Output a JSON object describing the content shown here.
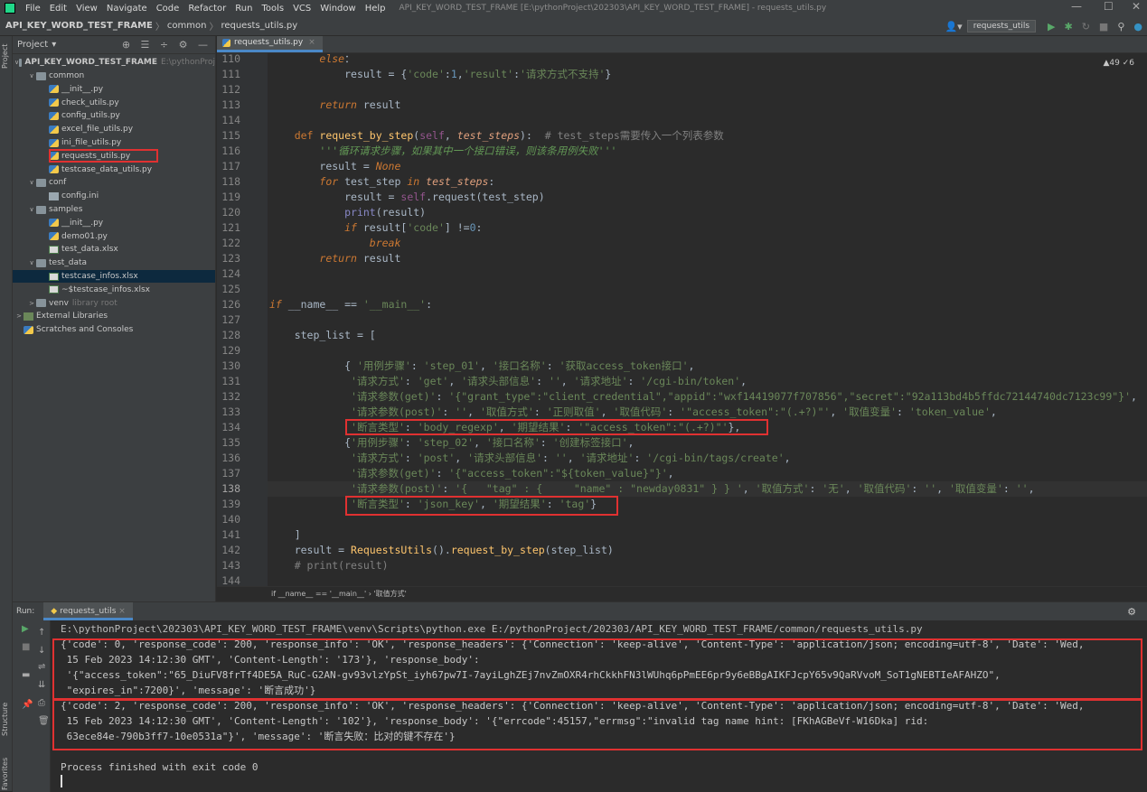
{
  "menubar": {
    "items": [
      "File",
      "Edit",
      "View",
      "Navigate",
      "Code",
      "Refactor",
      "Run",
      "Tools",
      "VCS",
      "Window",
      "Help"
    ],
    "window_title": "API_KEY_WORD_TEST_FRAME [E:\\pythonProject\\202303\\API_KEY_WORD_TEST_FRAME] - requests_utils.py"
  },
  "navbar": {
    "crumbs": [
      "API_KEY_WORD_TEST_FRAME",
      "common",
      "requests_utils.py"
    ],
    "run_config": "requests_utils"
  },
  "sidebar_vertical": {
    "project": "Project",
    "structure": "Structure",
    "favorites": "Favorites"
  },
  "project": {
    "title": "Project",
    "tree": [
      {
        "label": "API_KEY_WORD_TEST_FRAME",
        "extra": "E:\\pythonProj",
        "indent": 0,
        "arrow": "v",
        "icon": "folder",
        "bold": true
      },
      {
        "label": "common",
        "indent": 1,
        "arrow": "v",
        "icon": "folder"
      },
      {
        "label": "__init__.py",
        "indent": 2,
        "icon": "py"
      },
      {
        "label": "check_utils.py",
        "indent": 2,
        "icon": "py"
      },
      {
        "label": "config_utils.py",
        "indent": 2,
        "icon": "py"
      },
      {
        "label": "excel_file_utils.py",
        "indent": 2,
        "icon": "py"
      },
      {
        "label": "ini_file_utils.py",
        "indent": 2,
        "icon": "py"
      },
      {
        "label": "requests_utils.py",
        "indent": 2,
        "icon": "py"
      },
      {
        "label": "testcase_data_utils.py",
        "indent": 2,
        "icon": "py"
      },
      {
        "label": "conf",
        "indent": 1,
        "arrow": "v",
        "icon": "folder"
      },
      {
        "label": "config.ini",
        "indent": 2,
        "icon": "ini"
      },
      {
        "label": "samples",
        "indent": 1,
        "arrow": "v",
        "icon": "folder"
      },
      {
        "label": "__init__.py",
        "indent": 2,
        "icon": "py"
      },
      {
        "label": "demo01.py",
        "indent": 2,
        "icon": "py"
      },
      {
        "label": "test_data.xlsx",
        "indent": 2,
        "icon": "xls"
      },
      {
        "label": "test_data",
        "indent": 1,
        "arrow": "v",
        "icon": "folder"
      },
      {
        "label": "testcase_infos.xlsx",
        "indent": 2,
        "icon": "xls",
        "selected": true
      },
      {
        "label": "~$testcase_infos.xlsx",
        "indent": 2,
        "icon": "xls"
      },
      {
        "label": "venv",
        "extra": "library root",
        "indent": 1,
        "arrow": ">",
        "icon": "folder"
      },
      {
        "label": "External Libraries",
        "indent": 0,
        "arrow": ">",
        "icon": "lib"
      },
      {
        "label": "Scratches and Consoles",
        "indent": 0,
        "icon": "py"
      }
    ]
  },
  "editor": {
    "tab": "requests_utils.py",
    "inspection": "▲49  ✓6",
    "breadcrumb": "if __name__ == '__main__'  ›  '取值方式'",
    "line_numbers": [
      110,
      111,
      112,
      113,
      114,
      115,
      116,
      117,
      118,
      119,
      120,
      121,
      122,
      123,
      124,
      125,
      126,
      127,
      128,
      129,
      130,
      131,
      132,
      133,
      134,
      135,
      136,
      137,
      138,
      139,
      140,
      141,
      142,
      143,
      144
    ],
    "lines": [
      {
        "indent": "        ",
        "segs": [
          [
            "kwi",
            "else"
          ],
          [
            "",
            "："
          ]
        ]
      },
      {
        "indent": "            ",
        "segs": [
          [
            "",
            "result = {"
          ],
          [
            "st",
            "'code'"
          ],
          [
            "",
            ":"
          ],
          [
            "nu",
            "1"
          ],
          [
            "",
            ","
          ],
          [
            "st",
            "'result'"
          ],
          [
            "",
            ":"
          ],
          [
            "st",
            "'请求方式不支持'"
          ],
          [
            "",
            "}"
          ]
        ]
      },
      {
        "indent": "",
        "segs": []
      },
      {
        "indent": "        ",
        "segs": [
          [
            "kwi",
            "return"
          ],
          [
            "",
            " result"
          ]
        ]
      },
      {
        "indent": "",
        "segs": []
      },
      {
        "indent": "    ",
        "segs": [
          [
            "kw",
            "def "
          ],
          [
            "fn",
            "request_by_step"
          ],
          [
            "",
            "("
          ],
          [
            "se",
            "self"
          ],
          [
            "",
            ", "
          ],
          [
            "param",
            "test_steps"
          ],
          [
            "",
            "):  "
          ],
          [
            "cm",
            "# test_steps需要传入一个列表参数"
          ]
        ]
      },
      {
        "indent": "        ",
        "segs": [
          [
            "dc",
            "'''循环请求步骤，如果其中一个接口错误，则该条用例失败'''"
          ]
        ]
      },
      {
        "indent": "        ",
        "segs": [
          [
            "",
            "result = "
          ],
          [
            "kwi",
            "None"
          ]
        ]
      },
      {
        "indent": "        ",
        "segs": [
          [
            "kwi",
            "for"
          ],
          [
            "",
            " test_step "
          ],
          [
            "kwi",
            "in"
          ],
          [
            "",
            " "
          ],
          [
            "param",
            "test_steps"
          ],
          [
            "",
            ":"
          ]
        ]
      },
      {
        "indent": "            ",
        "segs": [
          [
            "",
            "result = "
          ],
          [
            "se",
            "self"
          ],
          [
            "",
            ".request(test_step)"
          ]
        ]
      },
      {
        "indent": "            ",
        "segs": [
          [
            "bi",
            "print"
          ],
          [
            "",
            "(result)"
          ]
        ]
      },
      {
        "indent": "            ",
        "segs": [
          [
            "kwi",
            "if"
          ],
          [
            "",
            " result["
          ],
          [
            "st",
            "'code'"
          ],
          [
            "",
            "] !="
          ],
          [
            "nu",
            "0"
          ],
          [
            "",
            ":"
          ]
        ]
      },
      {
        "indent": "                ",
        "segs": [
          [
            "kwi",
            "break"
          ]
        ]
      },
      {
        "indent": "        ",
        "segs": [
          [
            "kwi",
            "return"
          ],
          [
            "",
            " result"
          ]
        ]
      },
      {
        "indent": "",
        "segs": []
      },
      {
        "indent": "",
        "segs": []
      },
      {
        "indent": "",
        "segs": [
          [
            "kwi",
            "if"
          ],
          [
            "",
            " __name__ == "
          ],
          [
            "st",
            "'__main__'"
          ],
          [
            "",
            ":"
          ]
        ]
      },
      {
        "indent": "",
        "segs": []
      },
      {
        "indent": "    ",
        "segs": [
          [
            "",
            "step_list = ["
          ]
        ]
      },
      {
        "indent": "",
        "segs": []
      },
      {
        "indent": "            ",
        "segs": [
          [
            "",
            "{ "
          ],
          [
            "st",
            "'用例步骤'"
          ],
          [
            "",
            ": "
          ],
          [
            "st",
            "'step_01'"
          ],
          [
            "",
            ", "
          ],
          [
            "st",
            "'接口名称'"
          ],
          [
            "",
            ": "
          ],
          [
            "st",
            "'获取access_token接口'"
          ],
          [
            "",
            ","
          ]
        ]
      },
      {
        "indent": "             ",
        "segs": [
          [
            "st",
            "'请求方式'"
          ],
          [
            "",
            ": "
          ],
          [
            "st",
            "'get'"
          ],
          [
            "",
            ", "
          ],
          [
            "st",
            "'请求头部信息'"
          ],
          [
            "",
            ": "
          ],
          [
            "st",
            "''"
          ],
          [
            "",
            ", "
          ],
          [
            "st",
            "'请求地址'"
          ],
          [
            "",
            ": "
          ],
          [
            "st",
            "'/cgi-bin/token'"
          ],
          [
            "",
            ","
          ]
        ]
      },
      {
        "indent": "             ",
        "segs": [
          [
            "st",
            "'请求参数(get)'"
          ],
          [
            "",
            ": "
          ],
          [
            "st",
            "'{\"grant_type\":\"client_credential\",\"appid\":\"wxf14419077f707856\",\"secret\":\"92a113bd4b5ffdc72144740dc7123c99\"}'"
          ],
          [
            "",
            ","
          ]
        ]
      },
      {
        "indent": "             ",
        "segs": [
          [
            "st",
            "'请求参数(post)'"
          ],
          [
            "",
            ": "
          ],
          [
            "st",
            "''"
          ],
          [
            "",
            ", "
          ],
          [
            "st",
            "'取值方式'"
          ],
          [
            "",
            ": "
          ],
          [
            "st",
            "'正则取值'"
          ],
          [
            "",
            ", "
          ],
          [
            "st",
            "'取值代码'"
          ],
          [
            "",
            ": "
          ],
          [
            "st",
            "'\"access_token\":\"(.+?)\"'"
          ],
          [
            "",
            ", "
          ],
          [
            "st",
            "'取值变量'"
          ],
          [
            "",
            ": "
          ],
          [
            "st",
            "'token_value'"
          ],
          [
            "",
            ","
          ]
        ]
      },
      {
        "indent": "             ",
        "segs": [
          [
            "st",
            "'断言类型'"
          ],
          [
            "",
            ": "
          ],
          [
            "st",
            "'body_regexp'"
          ],
          [
            "",
            ", "
          ],
          [
            "st",
            "'期望结果'"
          ],
          [
            "",
            ": "
          ],
          [
            "st",
            "'\"access_token\":\"(.+?)\"'"
          ],
          [
            "",
            "},"
          ]
        ]
      },
      {
        "indent": "            ",
        "segs": [
          [
            "",
            "{"
          ],
          [
            "st",
            "'用例步骤'"
          ],
          [
            "",
            ": "
          ],
          [
            "st",
            "'step_02'"
          ],
          [
            "",
            ", "
          ],
          [
            "st",
            "'接口名称'"
          ],
          [
            "",
            ": "
          ],
          [
            "st",
            "'创建标签接口'"
          ],
          [
            "",
            ","
          ]
        ]
      },
      {
        "indent": "             ",
        "segs": [
          [
            "st",
            "'请求方式'"
          ],
          [
            "",
            ": "
          ],
          [
            "st",
            "'post'"
          ],
          [
            "",
            ", "
          ],
          [
            "st",
            "'请求头部信息'"
          ],
          [
            "",
            ": "
          ],
          [
            "st",
            "''"
          ],
          [
            "",
            ", "
          ],
          [
            "st",
            "'请求地址'"
          ],
          [
            "",
            ": "
          ],
          [
            "st",
            "'/cgi-bin/tags/create'"
          ],
          [
            "",
            ","
          ]
        ]
      },
      {
        "indent": "             ",
        "segs": [
          [
            "st",
            "'请求参数(get)'"
          ],
          [
            "",
            ": "
          ],
          [
            "st",
            "'{\"access_token\":\"${token_value}\"}'"
          ],
          [
            "",
            ","
          ]
        ]
      },
      {
        "indent": "             ",
        "segs": [
          [
            "st",
            "'请求参数(post)'"
          ],
          [
            "",
            ": "
          ],
          [
            "st",
            "'{   \"tag\" : {     \"name\" : \"newday0831\" } } '"
          ],
          [
            "",
            ", "
          ],
          [
            "st",
            "'取值方式'"
          ],
          [
            "",
            ": "
          ],
          [
            "st",
            "'无'"
          ],
          [
            "",
            ", "
          ],
          [
            "st",
            "'取值代码'"
          ],
          [
            "",
            ": "
          ],
          [
            "st",
            "''"
          ],
          [
            "",
            ", "
          ],
          [
            "st",
            "'取值变量'"
          ],
          [
            "",
            ": "
          ],
          [
            "st",
            "''"
          ],
          [
            "",
            ","
          ]
        ]
      },
      {
        "indent": "             ",
        "segs": [
          [
            "st",
            "'断言类型'"
          ],
          [
            "",
            ": "
          ],
          [
            "st",
            "'json_key'"
          ],
          [
            "",
            ", "
          ],
          [
            "st",
            "'期望结果'"
          ],
          [
            "",
            ": "
          ],
          [
            "st",
            "'tag'"
          ],
          [
            "",
            "}"
          ]
        ]
      },
      {
        "indent": "",
        "segs": []
      },
      {
        "indent": "    ",
        "segs": [
          [
            "",
            "]"
          ]
        ]
      },
      {
        "indent": "    ",
        "segs": [
          [
            "",
            "result = "
          ],
          [
            "fn",
            "RequestsUtils"
          ],
          [
            "",
            "()."
          ],
          [
            "fn",
            "request_by_step"
          ],
          [
            "",
            "(step_list)"
          ]
        ]
      },
      {
        "indent": "    ",
        "segs": [
          [
            "cm",
            "# print(result)"
          ]
        ]
      },
      {
        "indent": "",
        "segs": []
      }
    ]
  },
  "run": {
    "label": "Run:",
    "tab": "requests_utils",
    "console": [
      "E:\\pythonProject\\202303\\API_KEY_WORD_TEST_FRAME\\venv\\Scripts\\python.exe E:/pythonProject/202303/API_KEY_WORD_TEST_FRAME/common/requests_utils.py",
      "{'code': 0, 'response_code': 200, 'response_info': 'OK', 'response_headers': {'Connection': 'keep-alive', 'Content-Type': 'application/json; encoding=utf-8', 'Date': 'Wed,",
      " 15 Feb 2023 14:12:30 GMT', 'Content-Length': '173'}, 'response_body':",
      " '{\"access_token\":\"65_DiuFV8frTf4DE5A_RuC-G2AN-gv93vlzYpSt_iyh67pw7I-7ayiLghZEj7nvZmOXR4rhCkkhFN3lWUhq6pPmEE6pr9y6eBBgAIKFJcpY65v9QaRVvoM_SoT1gNEBTIeAFAHZO\",",
      " \"expires_in\":7200}', 'message': '断言成功'}",
      "{'code': 2, 'response_code': 200, 'response_info': 'OK', 'response_headers': {'Connection': 'keep-alive', 'Content-Type': 'application/json; encoding=utf-8', 'Date': 'Wed,",
      " 15 Feb 2023 14:12:30 GMT', 'Content-Length': '102'}, 'response_body': '{\"errcode\":45157,\"errmsg\":\"invalid tag name hint: [FKhAGBeVf-W16Dka] rid:",
      " 63ece84e-790b3ff7-10e0531a\"}', 'message': '断言失败：比对的键不存在'}",
      "",
      "Process finished with exit code 0"
    ]
  },
  "colors": {
    "highlight_box": "#e03131",
    "selection": "#0d293e",
    "accent": "#4a88c7"
  }
}
